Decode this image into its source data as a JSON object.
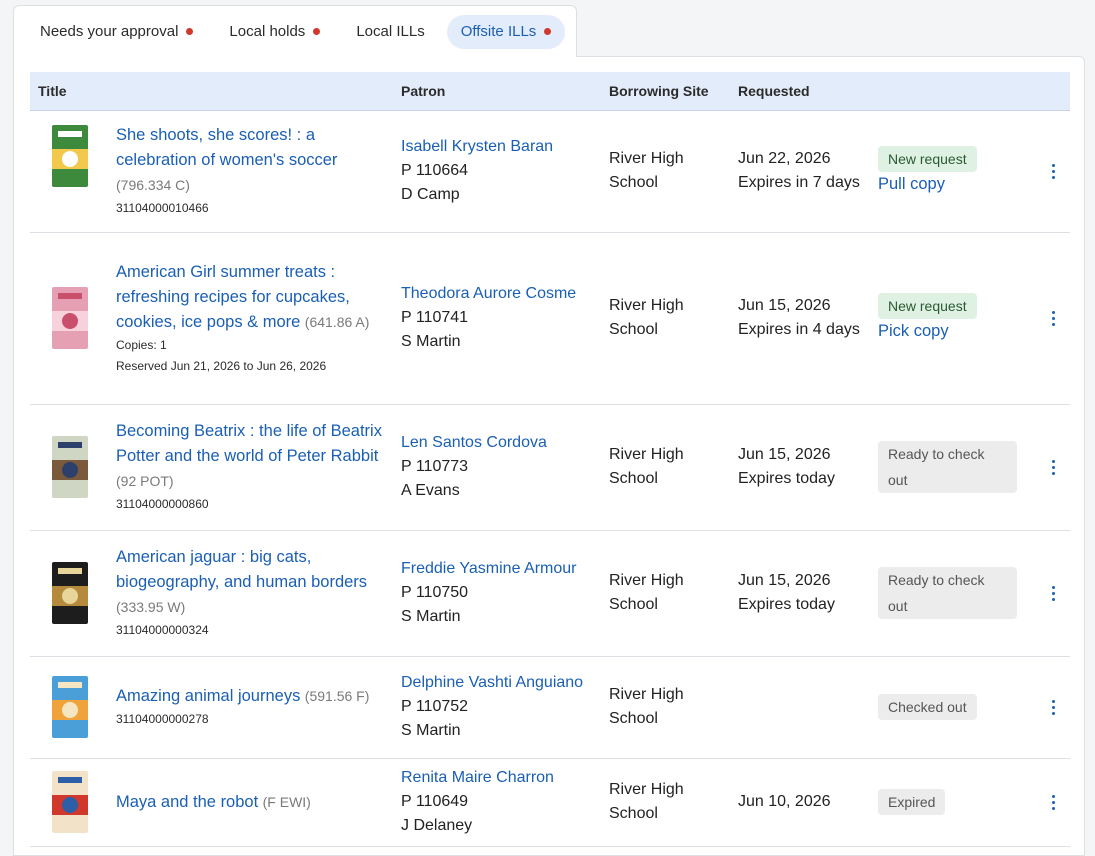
{
  "tabs": [
    {
      "label": "Needs your approval",
      "dot": true,
      "active": false
    },
    {
      "label": "Local holds",
      "dot": true,
      "active": false
    },
    {
      "label": "Local ILLs",
      "dot": false,
      "active": false
    },
    {
      "label": "Offsite ILLs",
      "dot": true,
      "active": true
    }
  ],
  "columns": {
    "title": "Title",
    "patron": "Patron",
    "site": "Borrowing Site",
    "requested": "Requested"
  },
  "colors": {
    "accent": "#1a5fb4",
    "tab_active_bg": "#e3ecfb",
    "dot": "#d0382b",
    "new_badge_bg": "#dff1e3",
    "grey_badge_bg": "#ececec"
  },
  "rows": [
    {
      "title": "She shoots, she scores! : a celebration of women's soccer",
      "call": "(796.334 C)",
      "copies": "",
      "reserved": "",
      "barcode": "31104000010466",
      "patron_name": "Isabell Krysten Baran",
      "patron_id": "P 110664",
      "teacher": "D Camp",
      "site_line1": "River High",
      "site_line2": "School",
      "requested_date": "Jun 22, 2026",
      "expires": "Expires in 7 days",
      "status": "New request",
      "status_kind": "new",
      "action": "Pull copy"
    },
    {
      "title": "American Girl summer treats : refreshing recipes for cupcakes, cookies, ice pops & more",
      "call": "(641.86 A)",
      "copies": "Copies: 1",
      "reserved": "Reserved Jun 21, 2026 to Jun 26, 2026",
      "barcode": "",
      "patron_name": "Theodora Aurore Cosme",
      "patron_id": "P 110741",
      "teacher": "S Martin",
      "site_line1": "River High",
      "site_line2": "School",
      "requested_date": "Jun 15, 2026",
      "expires": "Expires in 4 days",
      "status": "New request",
      "status_kind": "new",
      "action": "Pick copy"
    },
    {
      "title": "Becoming Beatrix : the life of Beatrix Potter and the world of Peter Rabbit",
      "call": "(92 POT)",
      "copies": "",
      "reserved": "",
      "barcode": "31104000000860",
      "patron_name": "Len Santos Cordova",
      "patron_id": "P 110773",
      "teacher": "A Evans",
      "site_line1": "River High",
      "site_line2": "School",
      "requested_date": "Jun 15, 2026",
      "expires": "Expires today",
      "status": "Ready to check out",
      "status_kind": "grey",
      "action": ""
    },
    {
      "title": "American jaguar : big cats, biogeography, and human borders",
      "call": "(333.95 W)",
      "copies": "",
      "reserved": "",
      "barcode": "31104000000324",
      "patron_name": "Freddie Yasmine Armour",
      "patron_id": "P 110750",
      "teacher": "S Martin",
      "site_line1": "River High",
      "site_line2": "School",
      "requested_date": "Jun 15, 2026",
      "expires": "Expires today",
      "status": "Ready to check out",
      "status_kind": "grey",
      "action": ""
    },
    {
      "title": "Amazing animal journeys",
      "call": "(591.56 F)",
      "copies": "",
      "reserved": "",
      "barcode": "31104000000278",
      "patron_name": "Delphine Vashti Anguiano",
      "patron_id": "P 110752",
      "teacher": "S Martin",
      "site_line1": "River High",
      "site_line2": "School",
      "requested_date": "",
      "expires": "",
      "status": "Checked out",
      "status_kind": "grey",
      "action": ""
    },
    {
      "title": "Maya and the robot",
      "call": "(F EWI)",
      "copies": "",
      "reserved": "",
      "barcode": "",
      "patron_name": "Renita Maire Charron",
      "patron_id": "P 110649",
      "teacher": "J Delaney",
      "site_line1": "River High",
      "site_line2": "School",
      "requested_date": "Jun 10, 2026",
      "expires": "",
      "status": "Expired",
      "status_kind": "grey",
      "action": ""
    }
  ]
}
